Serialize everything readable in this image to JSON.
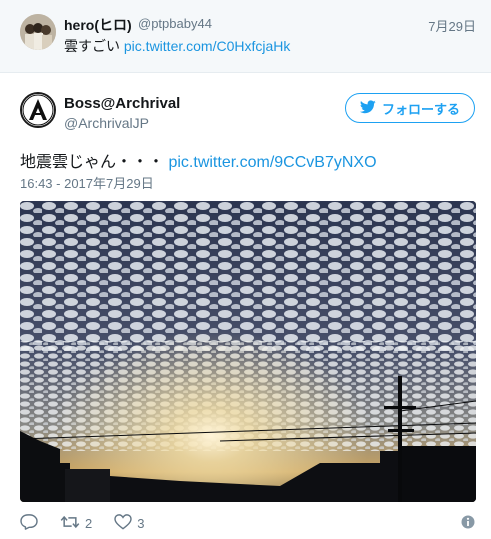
{
  "parent_tweet": {
    "display_name": "hero(ヒロ)",
    "handle": "@ptpbaby44",
    "date": "7月29日",
    "text": "雲すごい",
    "link": "pic.twitter.com/C0HxfcjaHk"
  },
  "main_tweet": {
    "display_name": "Boss@Archrival",
    "handle": "@ArchrivalJP",
    "follow_label": "フォローする",
    "text": "地震雲じゃん・・・",
    "link": "pic.twitter.com/9CCvB7yNXO",
    "timestamp": "16:43 - 2017年7月29日",
    "avatar_letter": "A"
  },
  "actions": {
    "retweet_count": "2",
    "like_count": "3"
  },
  "icons": {
    "reply": "reply-icon",
    "retweet": "retweet-icon",
    "like": "heart-icon",
    "info": "info-icon",
    "follow": "twitter-bird-icon"
  },
  "colors": {
    "accent": "#1da1f2",
    "link": "#1b95e0",
    "muted": "#657786",
    "parent_bg": "#f5f8fa"
  }
}
